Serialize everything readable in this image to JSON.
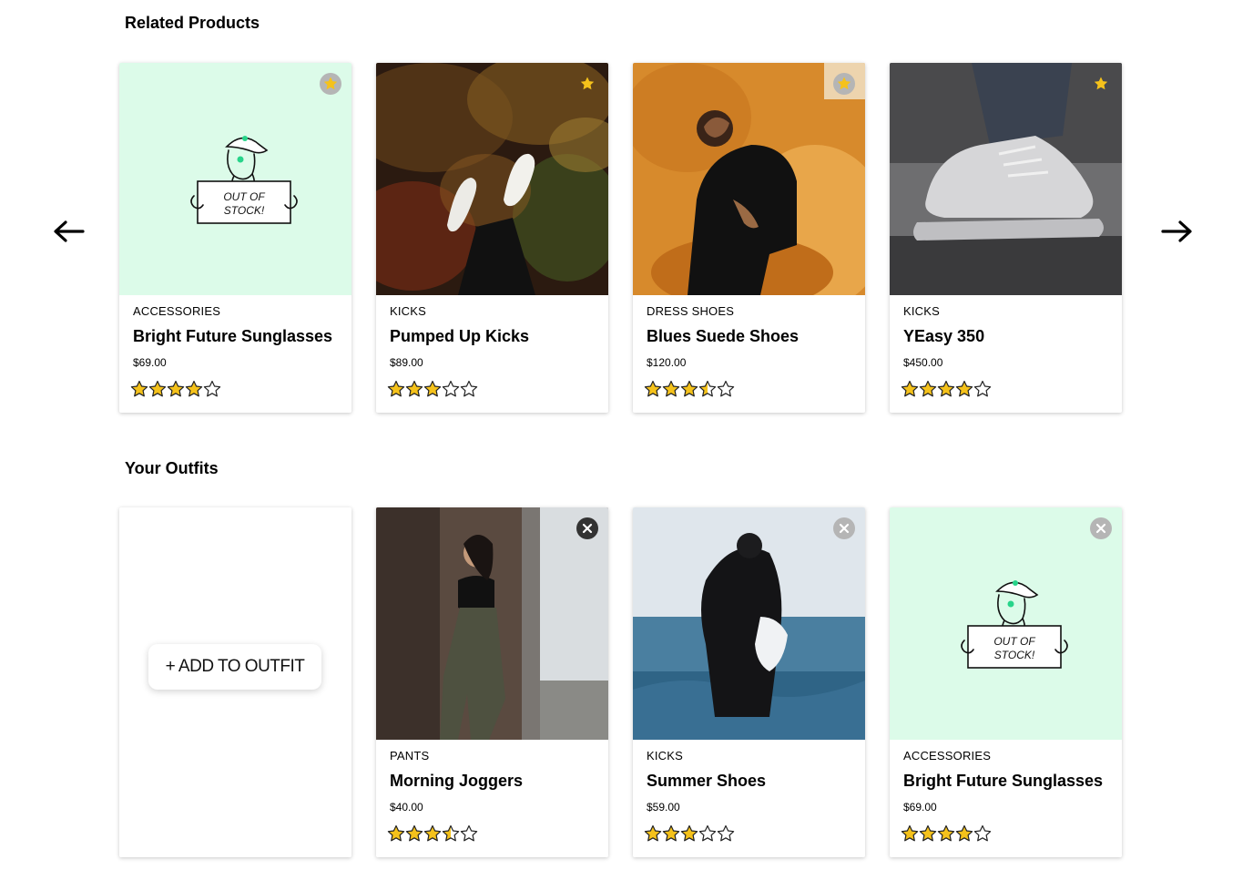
{
  "related": {
    "title": "Related Products",
    "prev_arrow_icon": "arrow-left-icon",
    "next_arrow_icon": "arrow-right-icon",
    "products": [
      {
        "category": "ACCESSORIES",
        "name": "Bright Future Sunglasses",
        "price": "$69.00",
        "rating": 4,
        "image": "out-of-stock-placeholder",
        "placeholder_text": [
          "OUT OF",
          "STOCK!"
        ],
        "action_icon": "star-icon"
      },
      {
        "category": "KICKS",
        "name": "Pumped Up Kicks",
        "price": "$89.00",
        "rating": 3,
        "image": "photo-sneakers-over-autumn-trees",
        "action_icon": "star-icon"
      },
      {
        "category": "DRESS SHOES",
        "name": "Blues Suede Shoes",
        "price": "$120.00",
        "rating": 3.5,
        "image": "photo-man-in-black-on-orange-fur",
        "action_icon": "star-icon"
      },
      {
        "category": "KICKS",
        "name": "YEasy 350",
        "price": "$450.00",
        "rating": 4,
        "image": "photo-white-sneaker-closeup",
        "action_icon": "star-icon"
      }
    ]
  },
  "outfits": {
    "title": "Your Outfits",
    "add_button_label": "+ ADD TO OUTFIT",
    "products": [
      {
        "category": "PANTS",
        "name": "Morning Joggers",
        "price": "$40.00",
        "rating": 3.5,
        "image": "photo-woman-in-cargo-joggers",
        "action_icon": "close-icon"
      },
      {
        "category": "KICKS",
        "name": "Summer Shoes",
        "price": "$59.00",
        "rating": 3,
        "image": "photo-man-holding-shoes-in-sea",
        "action_icon": "close-icon"
      },
      {
        "category": "ACCESSORIES",
        "name": "Bright Future Sunglasses",
        "price": "$69.00",
        "rating": 4,
        "image": "out-of-stock-placeholder",
        "placeholder_text": [
          "OUT OF",
          "STOCK!"
        ],
        "action_icon": "close-icon"
      }
    ]
  },
  "colors": {
    "star_fill": "#f5c21b",
    "placeholder_bg": "#dcfbe9",
    "placeholder_accent": "#27d48a"
  }
}
